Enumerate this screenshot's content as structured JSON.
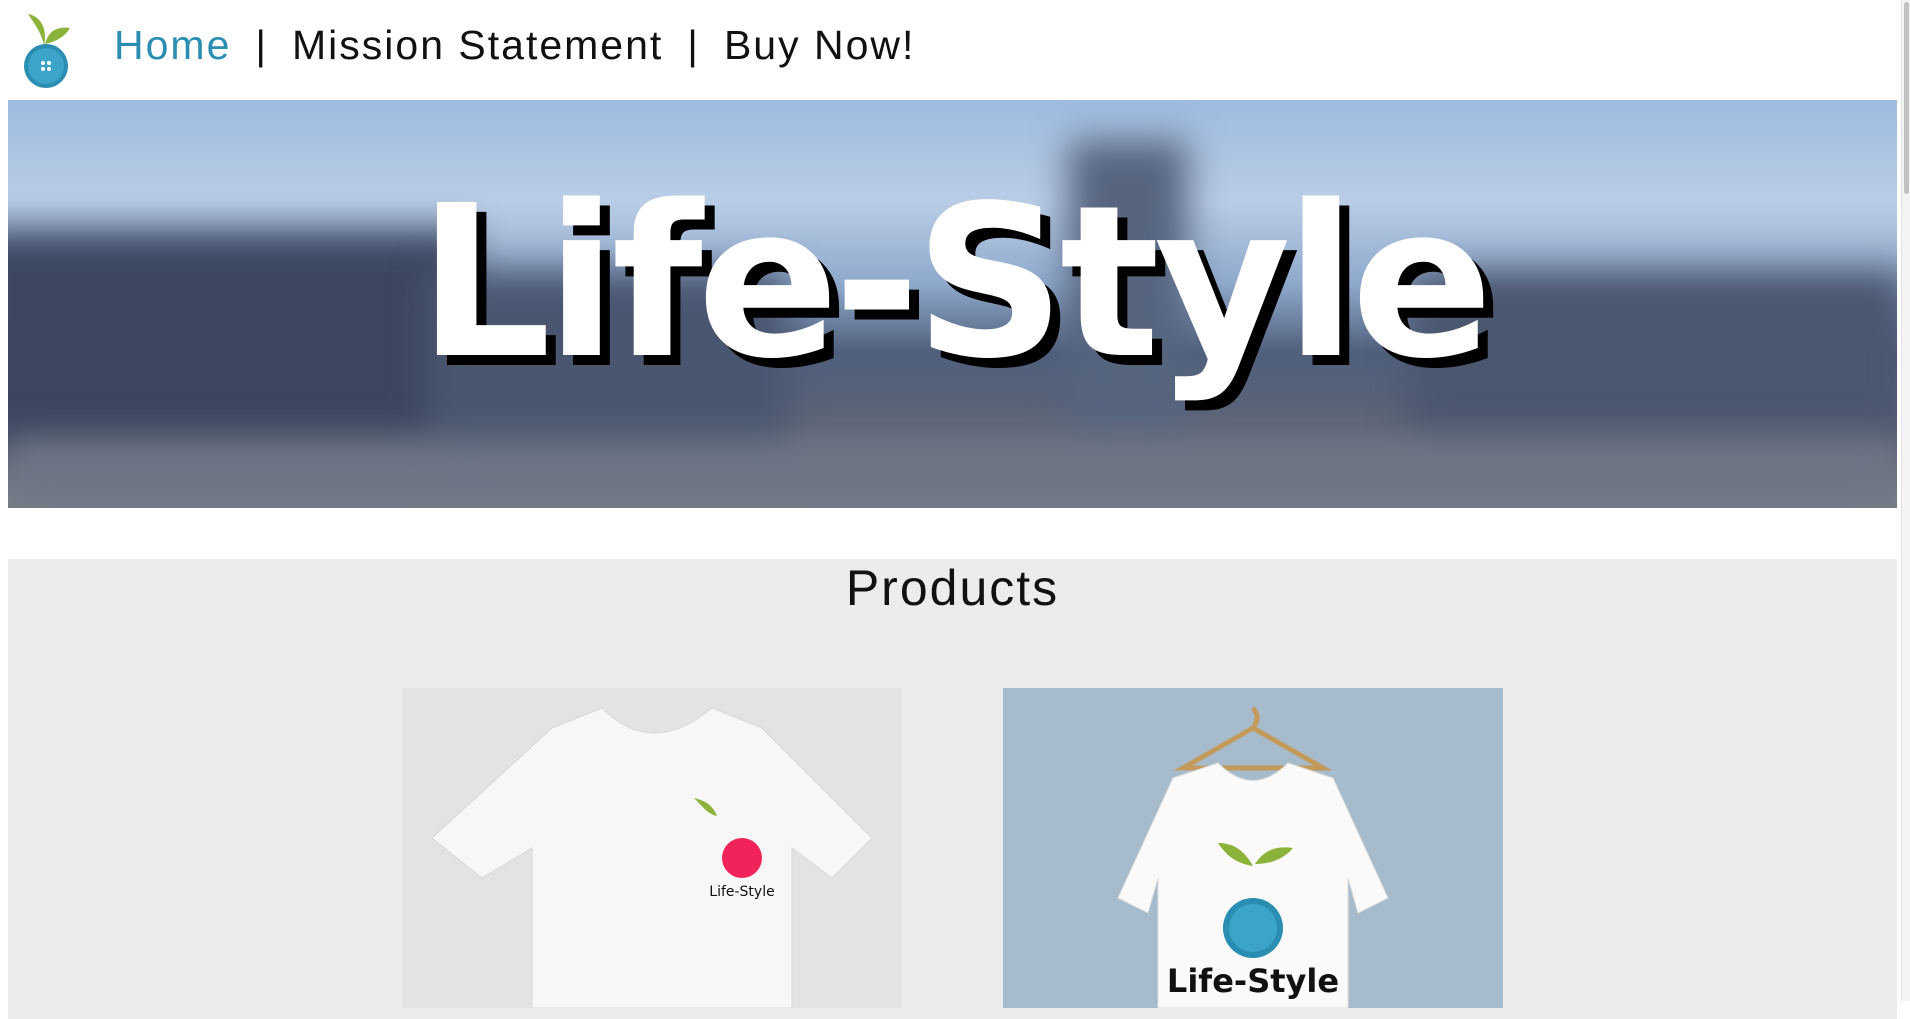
{
  "nav": {
    "links": [
      {
        "label": "Home",
        "active": true
      },
      {
        "label": "Mission Statement"
      },
      {
        "label": "Buy Now!"
      }
    ],
    "separator": "|"
  },
  "banner": {
    "title": "Life-Style"
  },
  "products": {
    "title": "Products",
    "items": [
      {
        "logo_text": "Life-Style",
        "logo_color": "#f0245a"
      },
      {
        "logo_text": "Life-Style",
        "logo_color": "#2a8db2"
      }
    ]
  },
  "colors": {
    "accent": "#2a8db2",
    "leaf": "#8bb33a"
  }
}
